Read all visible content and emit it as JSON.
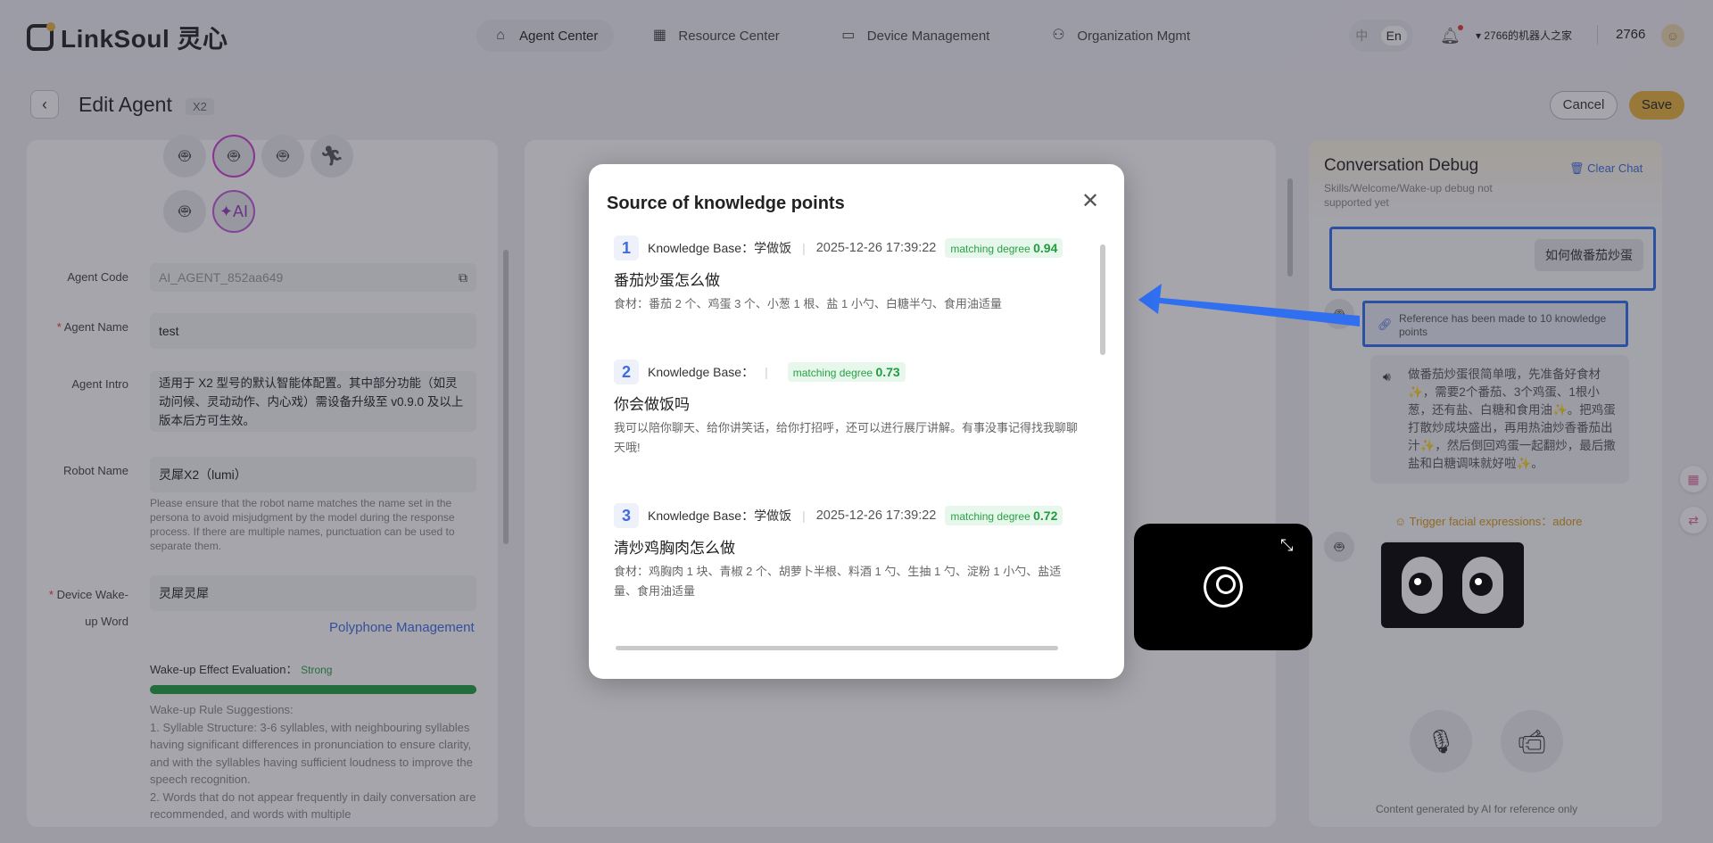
{
  "brand": {
    "name": "LinkSoul 灵心"
  },
  "nav": [
    {
      "label": "Agent Center",
      "icon": "home-icon",
      "active": true
    },
    {
      "label": "Resource Center",
      "icon": "grid-icon",
      "active": false
    },
    {
      "label": "Device Management",
      "icon": "monitor-icon",
      "active": false
    },
    {
      "label": "Organization Mgmt",
      "icon": "org-icon",
      "active": false
    }
  ],
  "lang": {
    "zh": "中",
    "en": "En"
  },
  "header": {
    "org": "2766的机器人之家",
    "user_id": "2766"
  },
  "page": {
    "title": "Edit Agent",
    "badge": "X2",
    "cancel": "Cancel",
    "save": "Save"
  },
  "left": {
    "agent_code_label": "Agent Code",
    "agent_code": "AI_AGENT_852aa649",
    "agent_name_label": "Agent Name",
    "agent_name": "test",
    "agent_intro_label": "Agent Intro",
    "agent_intro": "适用于 X2 型号的默认智能体配置。其中部分功能（如灵动问候、灵动动作、内心戏）需设备升级至 v0.9.0 及以上版本后方可生效。",
    "robot_name_label": "Robot Name",
    "robot_name": "灵犀X2（lumi）",
    "robot_name_hint": "Please ensure that the robot name matches the name set in the persona to avoid misjudgment by the model during the response process. If there are multiple names, punctuation can be used to separate them.",
    "wake_label_1": "Device Wake-",
    "wake_label_2": "up Word",
    "wake_word": "灵犀灵犀",
    "polyphone": "Polyphone Management",
    "wake_eval_label": "Wake-up Effect Evaluation：",
    "wake_eval_value": "Strong",
    "wake_eval_level": 1.0,
    "rules_title": "Wake-up Rule Suggestions:",
    "rule_1": "1. Syllable Structure: 3-6 syllables, with neighbouring syllables having significant differences in pronunciation to ensure clarity, and with the syllables having sufficient loudness to improve the speech recognition.",
    "rule_2": "2. Words that do not appear frequently in daily conversation are recommended, and words with multiple"
  },
  "debug": {
    "title": "Conversation Debug",
    "subtitle": "Skills/Welcome/Wake-up debug not supported yet",
    "clear_chat": "Clear Chat",
    "user_message": "如何做番茄炒蛋",
    "reference": "Reference has been made to 10 knowledge points",
    "answer": "做番茄炒蛋很简单哦，先准备好食材✨，需要2个番茄、3个鸡蛋、1根小葱，还有盐、白糖和食用油✨。把鸡蛋打散炒成块盛出，再用热油炒香番茄出汁✨，然后倒回鸡蛋一起翻炒，最后撒盐和白糖调味就好啦✨。",
    "trigger": "Trigger facial expressions：adore",
    "disclaimer": "Content generated by AI for reference only"
  },
  "modal": {
    "title": "Source of knowledge points",
    "items": [
      {
        "num": "1",
        "kb_label": "Knowledge Base：",
        "kb": "学做饭",
        "date": "2025-12-26 17:39:22",
        "deg_label": "matching degree",
        "deg": "0.94",
        "question": "番茄炒蛋怎么做",
        "answer": "食材：番茄 2 个、鸡蛋 3 个、小葱 1 根、盐 1 小勺、白糖半勺、食用油适量"
      },
      {
        "num": "2",
        "kb_label": "Knowledge Base：",
        "kb": "",
        "date": "",
        "deg_label": "matching degree",
        "deg": "0.73",
        "question": "你会做饭吗",
        "answer": "我可以陪你聊天、给你讲笑话，给你打招呼，还可以进行展厅讲解。有事没事记得找我聊聊天哦!"
      },
      {
        "num": "3",
        "kb_label": "Knowledge Base：",
        "kb": "学做饭",
        "date": "2025-12-26 17:39:22",
        "deg_label": "matching degree",
        "deg": "0.72",
        "question": "清炒鸡胸肉怎么做",
        "answer": "食材：鸡胸肉 1 块、青椒 2 个、胡萝卜半根、料酒 1 勺、生抽 1 勺、淀粉 1 小勺、盐适量、食用油适量"
      }
    ]
  },
  "colors": {
    "accent": "#3f6be3",
    "brand": "#e8b33b",
    "highlight": "#2f6ff0",
    "success": "#1f9d3e"
  }
}
